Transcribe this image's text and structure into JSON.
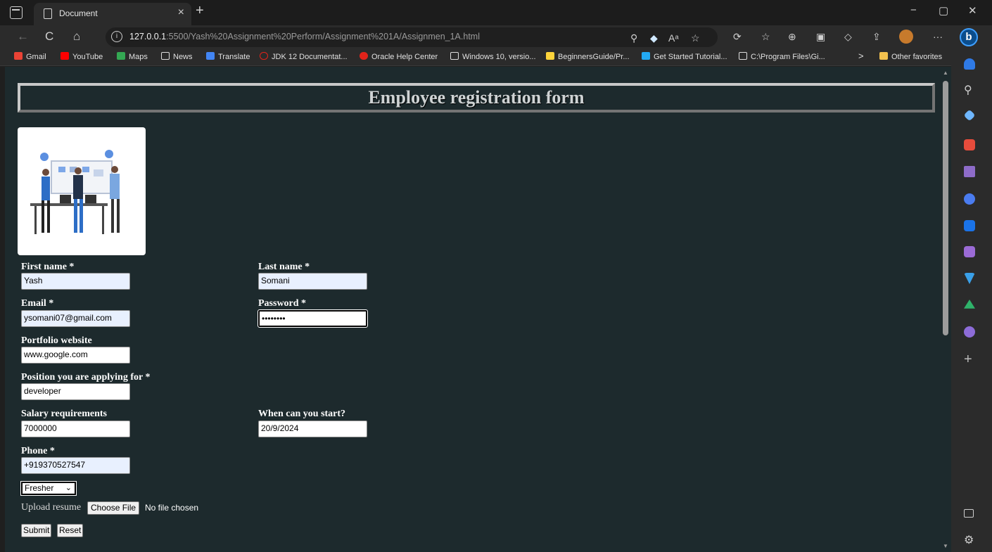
{
  "browser": {
    "tab_title": "Document",
    "url_host": "127.0.0.1",
    "url_rest": ":5500/Yash%20Assignment%20Perform/Assignment%201A/Assignmen_1A.html",
    "bookmarks": [
      "Gmail",
      "YouTube",
      "Maps",
      "News",
      "Translate",
      "JDK 12 Documentat...",
      "Oracle Help Center",
      "Windows 10, versio...",
      "BeginnersGuide/Pr...",
      "Get Started Tutorial...",
      "C:\\Program Files\\Gi..."
    ],
    "other_favorites": "Other favorites",
    "icons": {
      "back": "←",
      "refresh": "C",
      "home": "⌂",
      "close": "×",
      "new_tab": "+",
      "minimize": "−",
      "restore": "▢",
      "window_close": "✕",
      "more": "···",
      "chevron": ">",
      "sidebar_add": "+"
    }
  },
  "form": {
    "heading": "Employee registration form",
    "first_name_label": "First name *",
    "first_name_value": "Yash",
    "last_name_label": "Last name *",
    "last_name_value": "Somani",
    "email_label": "Email *",
    "email_value": "ysomani07@gmail.com",
    "password_label": "Password *",
    "password_value": "••••••••",
    "portfolio_label": "Portfolio website",
    "portfolio_value": "www.google.com",
    "position_label": "Position you are applying for *",
    "position_value": "developer",
    "salary_label": "Salary requirements",
    "salary_value": "7000000",
    "start_label": "When can you start?",
    "start_value": "20/9/2024",
    "phone_label": "Phone *",
    "phone_value": "+919370527547",
    "experience_selected": "Fresher",
    "upload_label": "Upload resume",
    "choose_file_label": "Choose File",
    "no_file_text": "No file chosen",
    "submit_label": "Submit",
    "reset_label": "Reset"
  },
  "colors": {
    "page_background": "#1d2a2d",
    "autofill_background": "#e8f0fe"
  }
}
